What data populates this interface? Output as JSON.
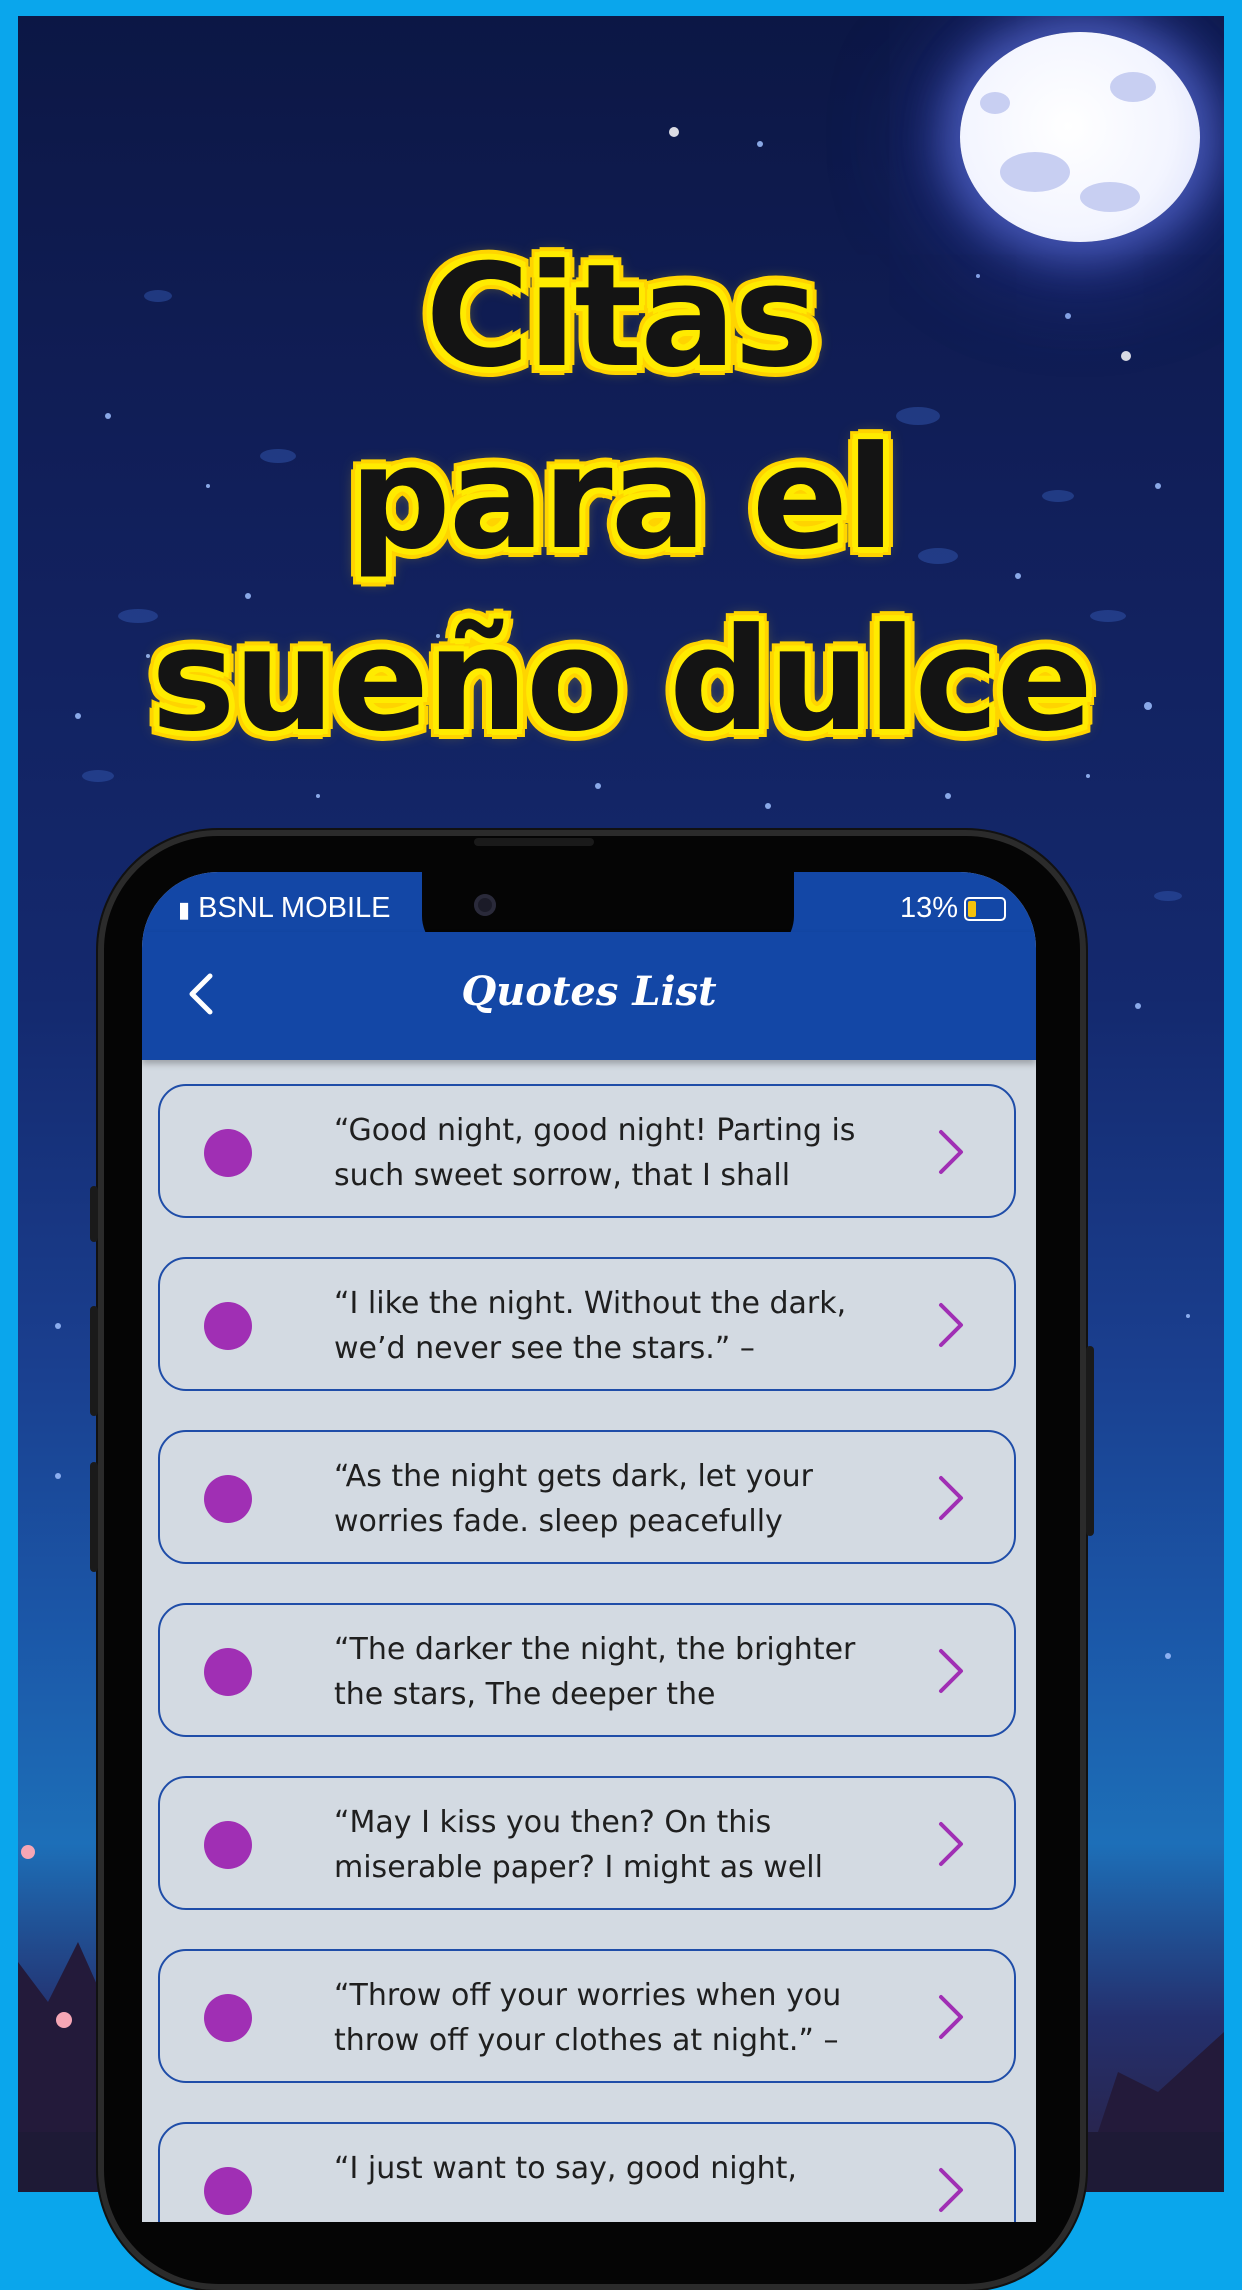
{
  "headline": {
    "line1": "Citas",
    "line2": "para el",
    "line3": "sueño dulce"
  },
  "status_bar": {
    "carrier": "BSNL MOBILE",
    "battery": "13%"
  },
  "app_bar": {
    "title": "Quotes List"
  },
  "quotes": [
    {
      "text": "“Good night, good night! Parting is such sweet sorrow, that I shall"
    },
    {
      "text": "“I like the night. Without the dark, we’d never see the stars.” –"
    },
    {
      "text": "“As the night gets dark, let your worries fade. sleep peacefully"
    },
    {
      "text": "“The darker the night, the brighter the stars, The deeper the"
    },
    {
      "text": "“May I kiss you then? On this miserable paper? I might as well"
    },
    {
      "text": "“Throw off your worries when you throw off your clothes at night.” –"
    },
    {
      "text": "“I just want to say, good night,"
    }
  ],
  "colors": {
    "accent": "#1347a6",
    "bullet": "#a02fb4",
    "headline_outline": "#ffeb00",
    "border": "#0aa6ec"
  },
  "icons": {
    "back": "chevron-left-icon",
    "row": "chevron-right-icon",
    "bullet": "circle-icon"
  }
}
